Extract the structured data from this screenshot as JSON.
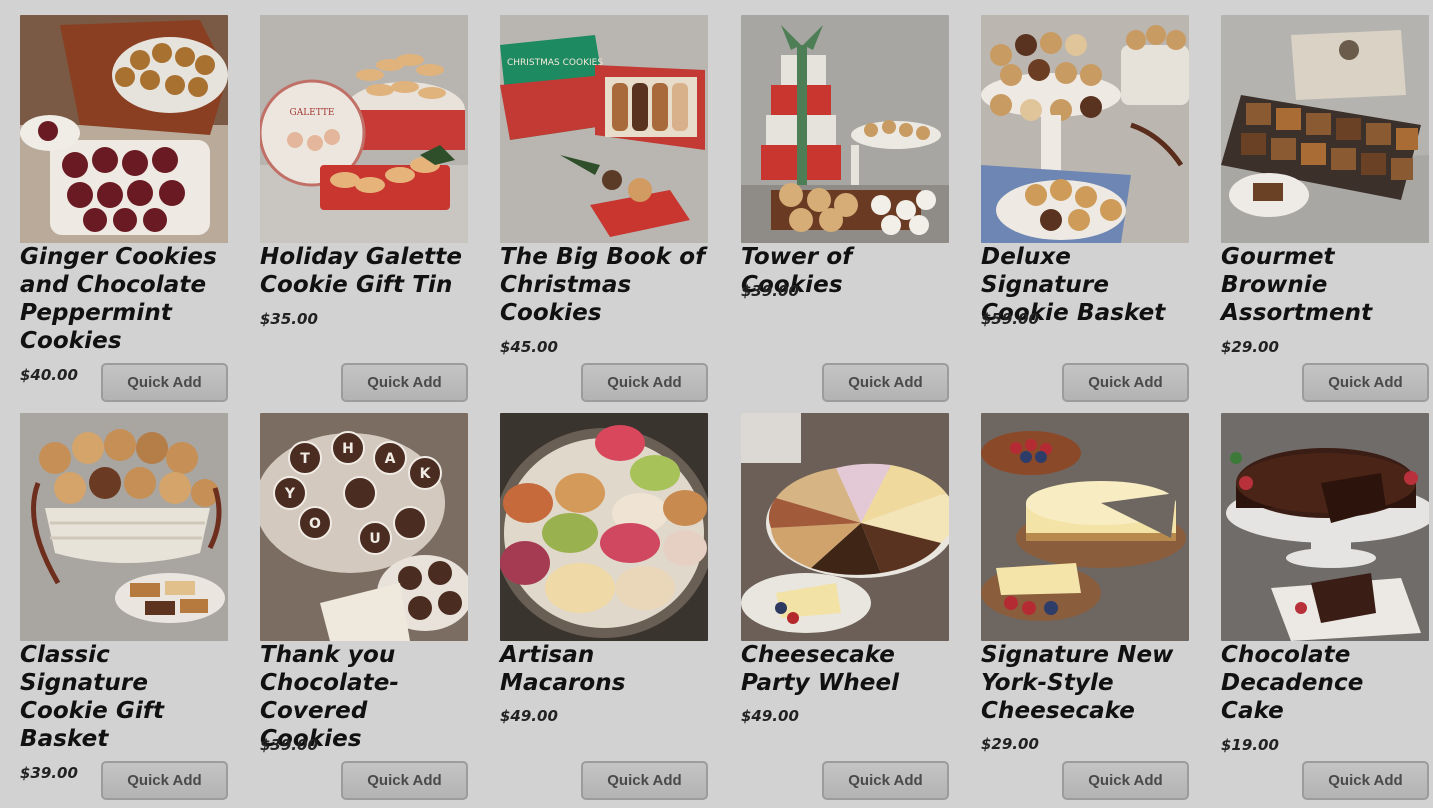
{
  "button_label": "Quick Add",
  "products": [
    {
      "title": "Ginger Cookies and Chocolate Peppermint Cookies",
      "price": "$40.00",
      "image": "cookie-plates-image"
    },
    {
      "title": "Holiday Galette Cookie Gift Tin",
      "price": "$35.00",
      "image": "cookie-tin-image"
    },
    {
      "title": "The Big Book of Christmas Cookies",
      "price": "$45.00",
      "image": "christmas-cookie-box-image"
    },
    {
      "title": "Tower of Cookies",
      "price": "$39.00",
      "image": "gift-tower-image"
    },
    {
      "title": "Deluxe Signature Cookie Basket",
      "price": "$59.00",
      "image": "cookie-basket-stand-image"
    },
    {
      "title": "Gourmet Brownie Assortment",
      "price": "$29.00",
      "image": "brownie-tray-image"
    },
    {
      "title": "Classic Signature Cookie Gift Basket",
      "price": "$39.00",
      "image": "cookie-basket-image"
    },
    {
      "title": "Thank you Chocolate-Covered Cookies",
      "price": "$39.00",
      "image": "thank-you-cookies-image"
    },
    {
      "title": "Artisan Macarons",
      "price": "$49.00",
      "image": "macarons-image"
    },
    {
      "title": "Cheesecake Party Wheel",
      "price": "$49.00",
      "image": "cheesecake-wheel-image"
    },
    {
      "title": "Signature New York-Style Cheesecake",
      "price": "$29.00",
      "image": "ny-cheesecake-image"
    },
    {
      "title": "Chocolate Decadence Cake",
      "price": "$19.00",
      "image": "chocolate-cake-image"
    }
  ]
}
